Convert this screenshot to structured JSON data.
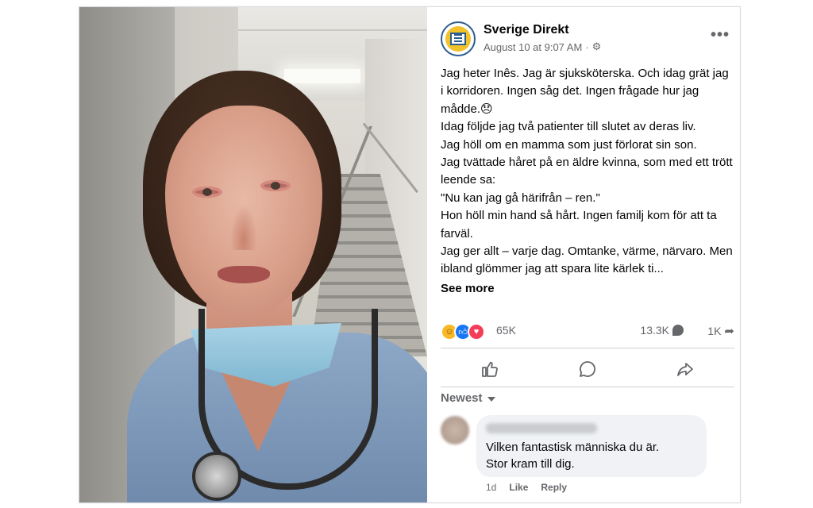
{
  "post": {
    "page_name": "Sverige Direkt",
    "date": "August 10 at 9:07 AM",
    "separator": "·",
    "more_label": "•••",
    "lines": [
      "Jag heter Inês. Jag är sjuksköterska. Och idag grät jag i korridoren. Ingen såg det. Ingen frågade hur jag mådde.😞",
      "Idag följde jag två patienter till slutet av deras liv.",
      "Jag höll om en mamma som just förlorat sin son.",
      "Jag tvättade håret på en äldre kvinna, som med ett trött leende sa:",
      "\"Nu kan jag gå härifrån – ren.\"",
      "Hon höll min hand så hårt. Ingen familj kom för att ta farväl.",
      "Jag ger allt – varje dag. Omtanke, värme, närvaro. Men ibland glömmer jag att spara lite kärlek ti..."
    ],
    "see_more": "See more"
  },
  "stats": {
    "reactions": "65K",
    "comments": "13.3K",
    "shares": "1K"
  },
  "comments_sort": "Newest",
  "comment": {
    "text_line1": "Vilken fantastisk människa du är.",
    "text_line2": "Stor kram till dig.",
    "age": "1d",
    "like_label": "Like",
    "reply_label": "Reply"
  },
  "icons": {
    "avatar": "newspaper-icon",
    "meta": "gear-icon",
    "like": "thumbs-up-icon",
    "comment": "comment-bubble-icon",
    "share": "share-arrow-icon"
  },
  "colors": {
    "text": "#050505",
    "secondary": "#65676b",
    "like_blue": "#1877f2",
    "love_red": "#f33e58",
    "care_yellow": "#f7b928",
    "bubble_bg": "#f0f2f5"
  }
}
